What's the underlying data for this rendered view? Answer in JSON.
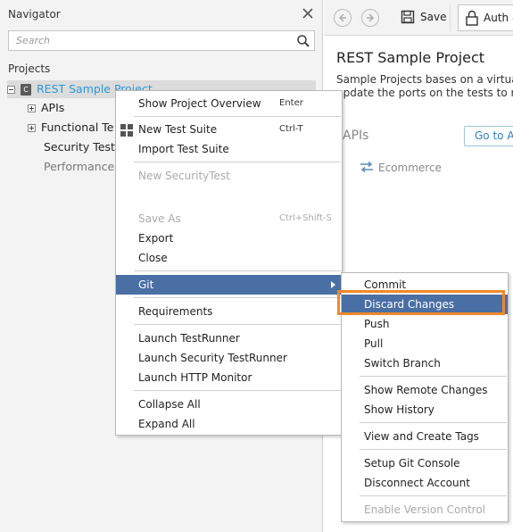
{
  "navigator": {
    "title": "Navigator",
    "search_placeholder": "Search",
    "projects_label": "Projects",
    "tree": {
      "root": {
        "label": "REST Sample Project",
        "icon_text": "C"
      },
      "children": [
        {
          "label": "APIs",
          "expander": true
        },
        {
          "label": "Functional Te",
          "expander": true
        },
        {
          "label": "Security Tests",
          "expander": false
        },
        {
          "label": "Performance",
          "expander": false
        }
      ]
    }
  },
  "toolbar": {
    "save_label": "Save",
    "auth_label": "Auth &"
  },
  "editor": {
    "title": "REST Sample Project",
    "description_line1": "Sample Projects bases on a virtualiz",
    "description_line2": "update the ports on the tests to reflec",
    "apis_heading": "APIs",
    "goto_label": "Go to AP",
    "ecommerce_label": "Ecommerce"
  },
  "context_menu": {
    "items": [
      {
        "label": "Show Project Overview",
        "shortcut": "Enter",
        "disabled": false
      },
      {
        "label": "New Test Suite",
        "shortcut": "Ctrl-T",
        "disabled": false,
        "icon": "grid-icon"
      },
      {
        "label": "Import Test Suite",
        "shortcut": "",
        "disabled": false
      },
      {
        "label": "New SecurityTest",
        "shortcut": "",
        "disabled": true
      },
      {
        "label": "Save As",
        "shortcut": "Ctrl+Shift-S",
        "disabled": true
      },
      {
        "label": "Export",
        "shortcut": "",
        "disabled": false
      },
      {
        "label": "Close",
        "shortcut": "",
        "disabled": false
      },
      {
        "label": "Git",
        "shortcut": "",
        "disabled": false,
        "submenu": true
      },
      {
        "label": "Requirements",
        "shortcut": "",
        "disabled": false
      },
      {
        "label": "Launch TestRunner",
        "shortcut": "",
        "disabled": false
      },
      {
        "label": "Launch Security TestRunner",
        "shortcut": "",
        "disabled": false
      },
      {
        "label": "Launch HTTP Monitor",
        "shortcut": "",
        "disabled": false
      },
      {
        "label": "Collapse All",
        "shortcut": "",
        "disabled": false
      },
      {
        "label": "Expand All",
        "shortcut": "",
        "disabled": false
      }
    ]
  },
  "git_submenu": {
    "items": [
      {
        "label": "Commit",
        "disabled": false
      },
      {
        "label": "Discard Changes",
        "disabled": false
      },
      {
        "label": "Push",
        "disabled": false
      },
      {
        "label": "Pull",
        "disabled": false
      },
      {
        "label": "Switch Branch",
        "disabled": false
      },
      {
        "label": "Show Remote Changes",
        "disabled": false
      },
      {
        "label": "Show History",
        "disabled": false
      },
      {
        "label": "View and Create Tags",
        "disabled": false
      },
      {
        "label": "Setup Git Console",
        "disabled": false
      },
      {
        "label": "Disconnect Account",
        "disabled": false
      },
      {
        "label": "Enable Version Control",
        "disabled": true
      }
    ]
  },
  "colors": {
    "highlight": "#4a6fa5",
    "callout": "#f0892b",
    "link": "#2a9ad6"
  }
}
